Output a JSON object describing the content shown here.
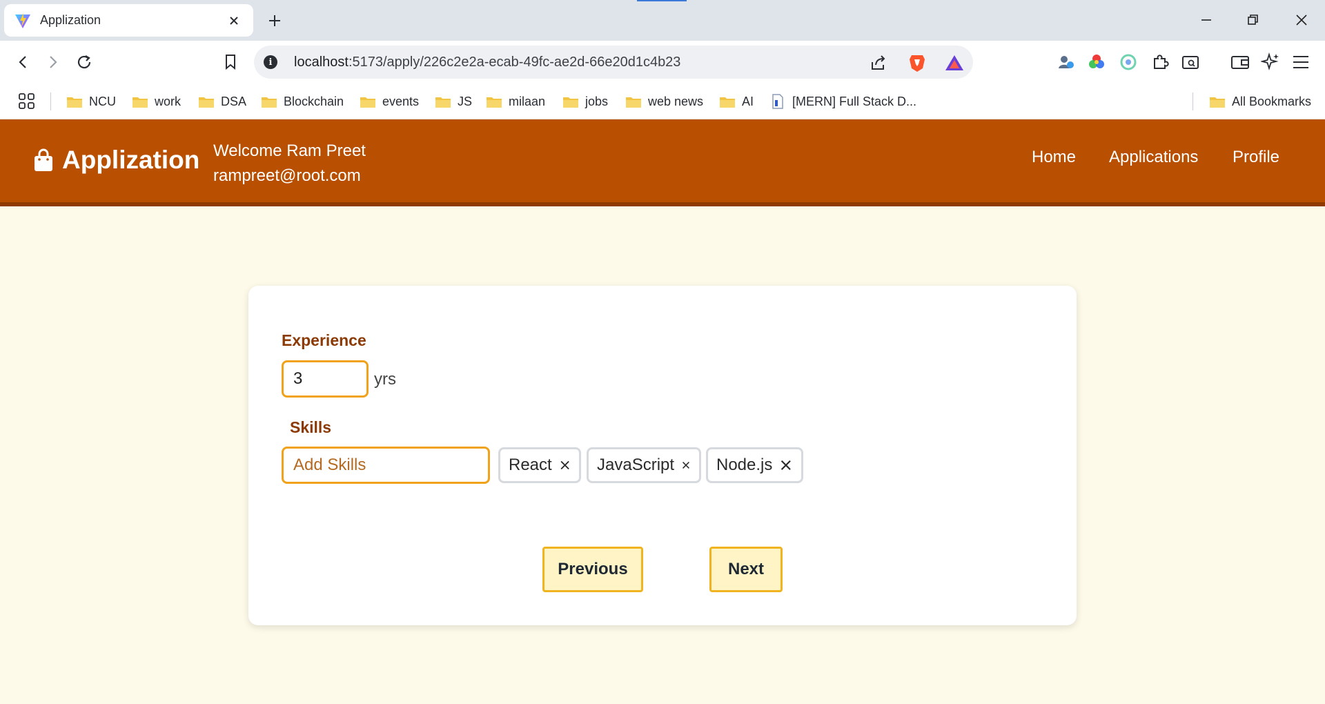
{
  "browser": {
    "tab_title": "Applization",
    "url_host": "localhost",
    "url_rest": ":5173/apply/226c2e2a-ecab-49fc-ae2d-66e20d1c4b23",
    "bookmarks": [
      "NCU",
      "work",
      "DSA",
      "Blockchain",
      "events",
      "JS",
      "milaan",
      "jobs",
      "web news",
      "AI",
      "[MERN] Full Stack D..."
    ],
    "all_bookmarks": "All Bookmarks"
  },
  "header": {
    "brand": "Applization",
    "welcome": "Welcome Ram Preet",
    "email": "rampreet@root.com",
    "nav": [
      "Home",
      "Applications",
      "Profile"
    ]
  },
  "form": {
    "experience_label": "Experience",
    "experience_value": "3",
    "experience_unit": "yrs",
    "skills_label": "Skills",
    "skills_placeholder": "Add Skills",
    "skills": [
      "React",
      "JavaScript",
      "Node.js"
    ],
    "previous_label": "Previous",
    "next_label": "Next"
  },
  "colors": {
    "header": "#b94f00",
    "page_bg": "#fefaea",
    "accent_border": "#f0a21b",
    "label": "#8c3a05",
    "button_bg": "#fff4c6"
  }
}
